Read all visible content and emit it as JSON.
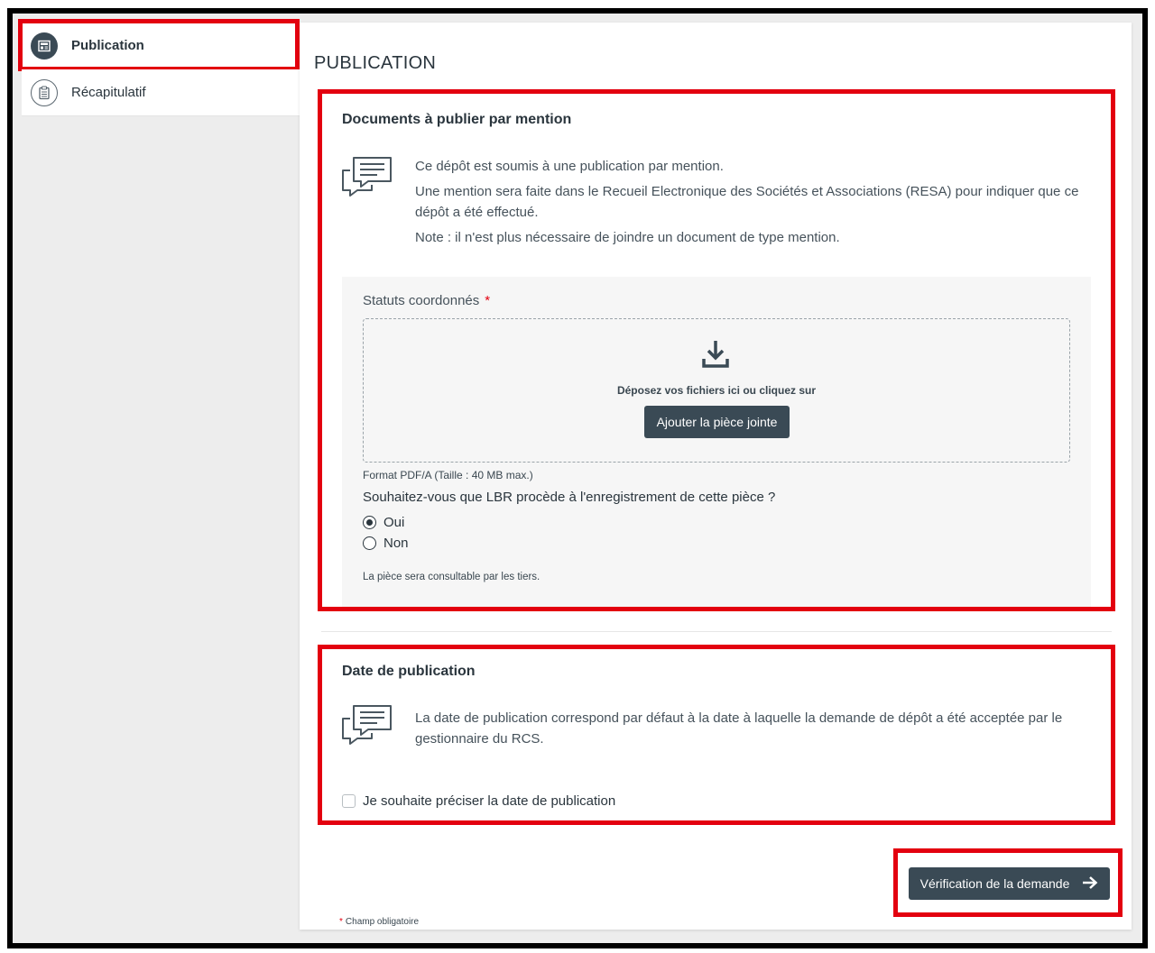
{
  "sidebar": {
    "items": [
      {
        "label": "Publication",
        "icon": "newspaper-icon",
        "active": true
      },
      {
        "label": "Récapitulatif",
        "icon": "clipboard-icon",
        "active": false
      }
    ]
  },
  "main": {
    "page_title": "PUBLICATION",
    "documents_section": {
      "title": "Documents à publier par mention",
      "info_lines": [
        "Ce dépôt est soumis à une publication par mention.",
        "Une mention sera faite dans le Recueil Electronique des Sociétés et Associations (RESA) pour indiquer que ce dépôt a été effectué.",
        "Note : il n'est plus nécessaire de joindre un document de type mention."
      ],
      "upload": {
        "label": "Statuts coordonnés",
        "required_mark": "*",
        "drop_text": "Déposez vos fichiers ici ou cliquez sur",
        "button_label": "Ajouter la pièce jointe",
        "format_note": "Format PDF/A (Taille : 40 MB max.)"
      },
      "question": "Souhaitez-vous que LBR procède à l'enregistrement de cette pièce ?",
      "options": [
        {
          "label": "Oui",
          "checked": true
        },
        {
          "label": "Non",
          "checked": false
        }
      ],
      "consult_note": "La pièce sera consultable par les tiers."
    },
    "date_section": {
      "title": "Date de publication",
      "info": "La date de publication correspond par défaut à la date à laquelle la demande de dépôt a été acceptée par le gestionnaire du RCS.",
      "checkbox_label": "Je souhaite préciser la date de publication",
      "checkbox_checked": false
    },
    "next_button_label": "Vérification de la demande",
    "required_note": "Champ obligatoire",
    "required_mark": "*"
  },
  "colors": {
    "highlight": "#e3000f",
    "button_bg": "#3a4a55",
    "page_bg": "#ededed"
  }
}
